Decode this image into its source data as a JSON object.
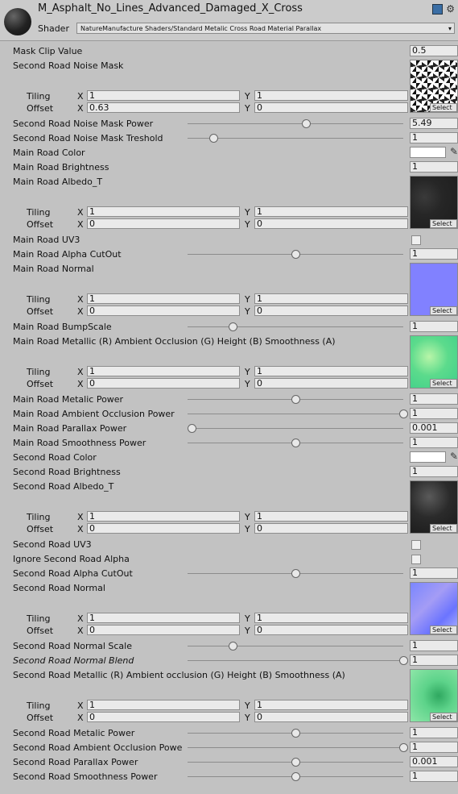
{
  "header": {
    "title": "M_Asphalt_No_Lines_Advanced_Damaged_X_Cross",
    "shader_label": "Shader",
    "shader_value": "NatureManufacture Shaders/Standard Metalic Cross Road Material Parallax"
  },
  "labels": {
    "tiling": "Tiling",
    "offset": "Offset",
    "x": "X",
    "y": "Y",
    "select": "Select"
  },
  "props": {
    "mask_clip_value": {
      "label": "Mask Clip Value",
      "value": "0.5"
    },
    "second_noise_mask": {
      "label": "Second Road Noise Mask",
      "tiling_x": "1",
      "tiling_y": "1",
      "offset_x": "0.63",
      "offset_y": "0"
    },
    "second_noise_mask_power": {
      "label": "Second Road Noise Mask Power",
      "value": "5.49",
      "slider": 0.55
    },
    "second_noise_mask_treshold": {
      "label": "Second Road Noise Mask Treshold",
      "value": "1",
      "slider": 0.12
    },
    "main_color": {
      "label": "Main Road Color",
      "color": "#ffffff"
    },
    "main_brightness": {
      "label": "Main Road Brightness",
      "value": "1"
    },
    "main_albedo": {
      "label": "Main Road Albedo_T",
      "tiling_x": "1",
      "tiling_y": "1",
      "offset_x": "0",
      "offset_y": "0"
    },
    "main_uv3": {
      "label": "Main Road UV3",
      "checked": false
    },
    "main_alpha_cutout": {
      "label": "Main Road Alpha CutOut",
      "value": "1",
      "slider": 0.5
    },
    "main_normal": {
      "label": "Main Road Normal",
      "tiling_x": "1",
      "tiling_y": "1",
      "offset_x": "0",
      "offset_y": "0"
    },
    "main_bumpscale": {
      "label": "Main Road BumpScale",
      "value": "1",
      "slider": 0.21
    },
    "main_mask_map": {
      "label": "Main Road Metallic (R) Ambient Occlusion (G) Height (B) Smoothness (A)",
      "tiling_x": "1",
      "tiling_y": "1",
      "offset_x": "0",
      "offset_y": "0"
    },
    "main_metalic_power": {
      "label": "Main Road Metalic Power",
      "value": "1",
      "slider": 0.5
    },
    "main_ao_power": {
      "label": "Main Road Ambient Occlusion Power",
      "value": "1",
      "slider": 1.0
    },
    "main_parallax_power": {
      "label": "Main Road Parallax Power",
      "value": "0.001",
      "slider": 0.02
    },
    "main_smoothness_power": {
      "label": "Main Road Smoothness Power",
      "value": "1",
      "slider": 0.5
    },
    "second_color": {
      "label": "Second Road Color",
      "color": "#ffffff"
    },
    "second_brightness": {
      "label": "Second Road Brightness",
      "value": "1"
    },
    "second_albedo": {
      "label": "Second Road Albedo_T",
      "tiling_x": "1",
      "tiling_y": "1",
      "offset_x": "0",
      "offset_y": "0"
    },
    "second_uv3": {
      "label": "Second Road UV3",
      "checked": false
    },
    "ignore_second_alpha": {
      "label": "Ignore Second Road Alpha",
      "checked": false
    },
    "second_alpha_cutout": {
      "label": "Second Road Alpha CutOut",
      "value": "1",
      "slider": 0.5
    },
    "second_normal": {
      "label": "Second Road Normal",
      "tiling_x": "1",
      "tiling_y": "1",
      "offset_x": "0",
      "offset_y": "0"
    },
    "second_normal_scale": {
      "label": "Second Road Normal Scale",
      "value": "1",
      "slider": 0.21
    },
    "second_normal_blend": {
      "label": "Second Road Normal Blend",
      "value": "1",
      "slider": 1.0
    },
    "second_mask_map": {
      "label": "Second Road Metallic (R) Ambient occlusion (G) Height (B) Smoothness (A)",
      "tiling_x": "1",
      "tiling_y": "1",
      "offset_x": "0",
      "offset_y": "0"
    },
    "second_metalic_power": {
      "label": "Second Road Metalic Power",
      "value": "1",
      "slider": 0.5
    },
    "second_ao_power": {
      "label": "Second Road Ambient Occlusion Powe",
      "value": "1",
      "slider": 1.0
    },
    "second_parallax_power": {
      "label": "Second Road Parallax Power",
      "value": "0.001",
      "slider": 0.5
    },
    "second_smoothness_power": {
      "label": "Second Road Smoothness Power",
      "value": "1",
      "slider": 0.5
    }
  }
}
